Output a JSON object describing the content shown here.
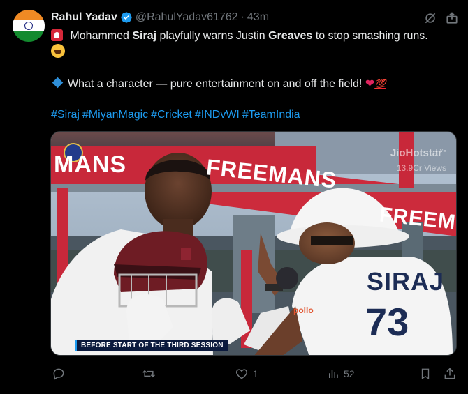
{
  "author": {
    "name": "Rahul Yadav",
    "handle": "@RahulYadav61762",
    "separator": "·",
    "time": "43m",
    "verified_icon": "verified-badge-icon",
    "avatar": "india-flag"
  },
  "tweet": {
    "line1_pre": " Mohammed ",
    "line1_bold1": "Siraj",
    "line1_mid": " playfully warns Justin ",
    "line1_bold2": "Greaves",
    "line1_post": " to stop smashing runs.",
    "line3_text": "What a character — pure entertainment on and off the field! ",
    "heart": "❤",
    "hundred": "💯",
    "hashtags": [
      "#Siraj",
      "#MiyanMagic",
      "#Cricket",
      "#INDvWI",
      "#TeamIndia"
    ]
  },
  "media": {
    "watermark": "JioHotstar",
    "live_tag": "LIVE",
    "views": "13.9Cr Views",
    "banner_caption": "BEFORE START OF THE THIRD SESSION",
    "board_text_left": "MANS",
    "board_text_mid": "FREEMANS",
    "board_text_right": "FREEM",
    "jersey_name": "SIRAJ",
    "jersey_number": "73"
  },
  "actions": {
    "reply_count": "",
    "repost_count": "",
    "like_count": "1",
    "views_count": "52"
  },
  "colors": {
    "background": "#000000",
    "text": "#e7e9ea",
    "muted": "#71767b",
    "link": "#1d9bf0",
    "verified": "#1d9bf0"
  }
}
